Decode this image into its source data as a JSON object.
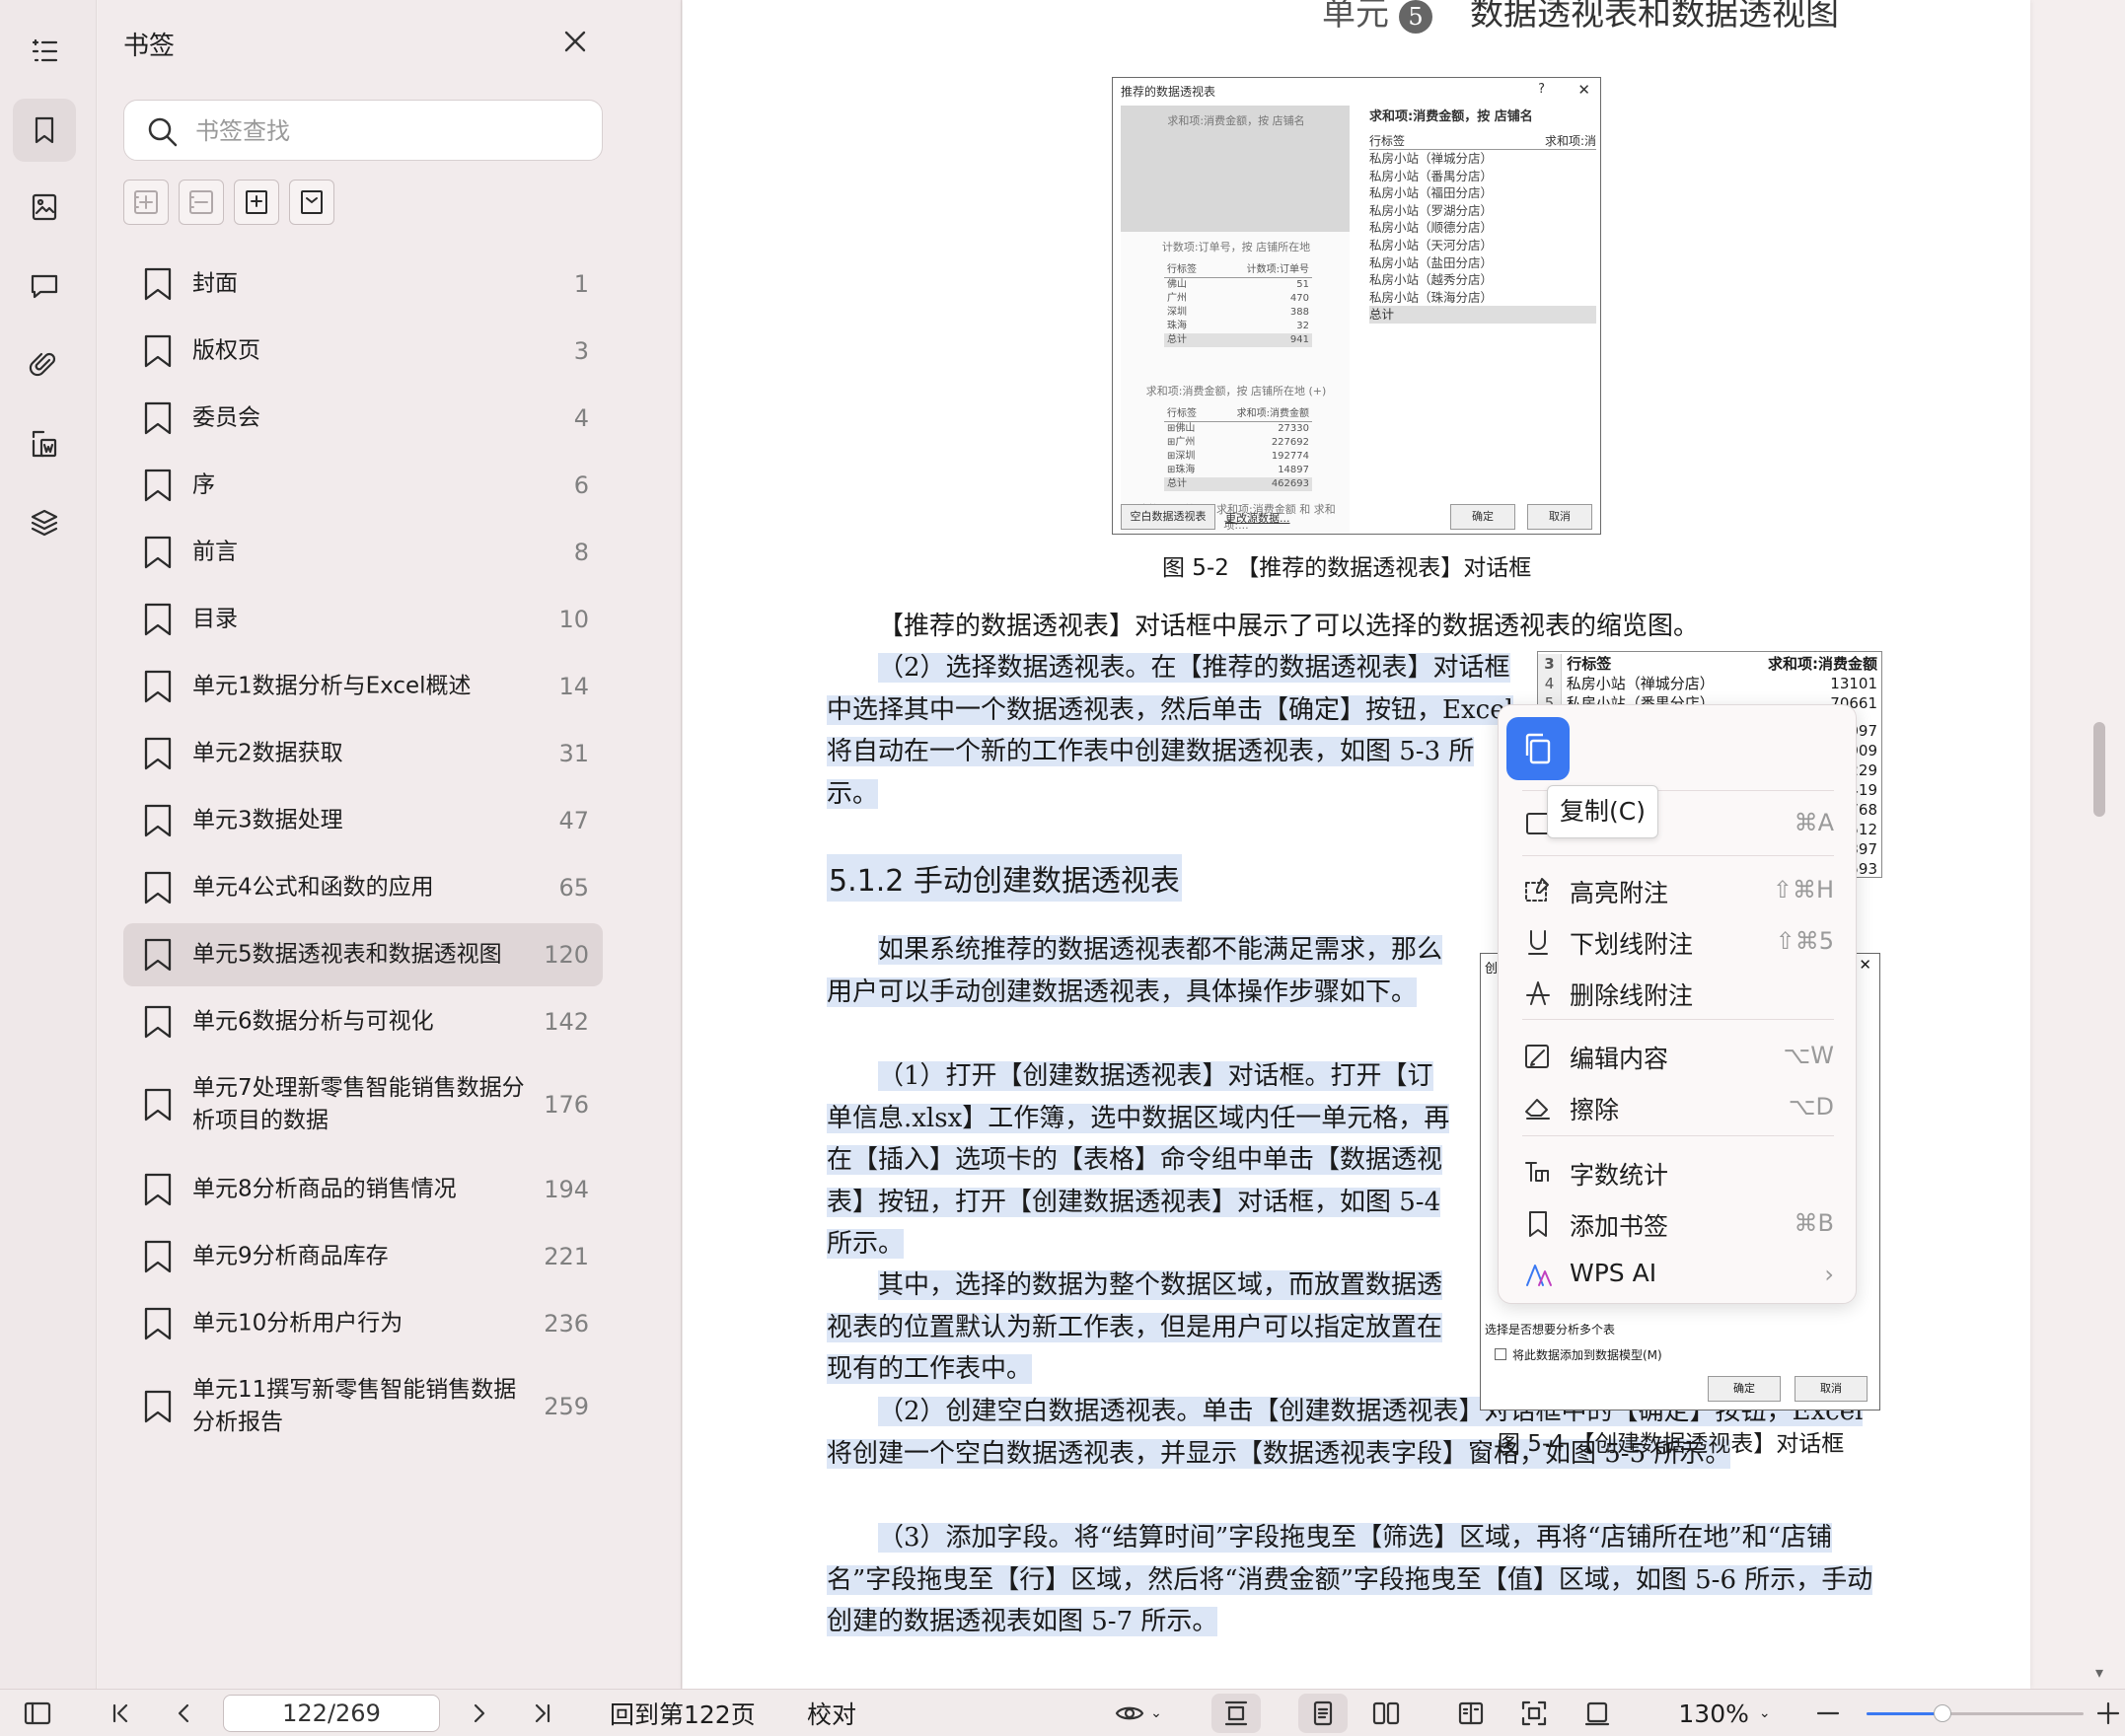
{
  "sidebar": {
    "title": "书签",
    "search_placeholder": "书签查找",
    "bookmarks": [
      {
        "label": "封面",
        "page": "1"
      },
      {
        "label": "版权页",
        "page": "3"
      },
      {
        "label": "委员会",
        "page": "4"
      },
      {
        "label": "序",
        "page": "6"
      },
      {
        "label": "前言",
        "page": "8"
      },
      {
        "label": "目录",
        "page": "10"
      },
      {
        "label": "单元1数据分析与Excel概述",
        "page": "14"
      },
      {
        "label": "单元2数据获取",
        "page": "31"
      },
      {
        "label": "单元3数据处理",
        "page": "47"
      },
      {
        "label": "单元4公式和函数的应用",
        "page": "65"
      },
      {
        "label": "单元5数据透视表和数据透视图",
        "page": "120"
      },
      {
        "label": "单元6数据分析与可视化",
        "page": "142"
      },
      {
        "label": "单元7处理新零售智能销售数据分析项目的数据",
        "page": "176"
      },
      {
        "label": "单元8分析商品的销售情况",
        "page": "194"
      },
      {
        "label": "单元9分析商品库存",
        "page": "221"
      },
      {
        "label": "单元10分析用户行为",
        "page": "236"
      },
      {
        "label": "单元11撰写新零售智能销售数据分析报告",
        "page": "259"
      }
    ],
    "active_index": 10
  },
  "document": {
    "unit_heading_prefix": "单元",
    "unit_number": "5",
    "unit_heading_title": "数据透视表和数据透视图",
    "fig2": {
      "title": "推荐的数据透视表",
      "help": "?",
      "cap1": "求和项:消费金额，按 店铺名",
      "cap2": "计数项:订单号，按 店铺所在地",
      "cap3": "求和项:消费金额，按 店铺所在地 (+)",
      "cap4": "计数项:订单号、求和项:消费金额 和 求和项:...",
      "t2_header": [
        "行标签",
        "计数项:订单号"
      ],
      "t2_rows": [
        [
          "佛山",
          "51"
        ],
        [
          "广州",
          "470"
        ],
        [
          "深圳",
          "388"
        ],
        [
          "珠海",
          "32"
        ]
      ],
      "t2_total": [
        "总计",
        "941"
      ],
      "t3_header": [
        "行标签",
        "求和项:消费金额"
      ],
      "t3_rows": [
        [
          "⊞佛山",
          "27330"
        ],
        [
          "⊞广州",
          "227692"
        ],
        [
          "⊞深圳",
          "192774"
        ],
        [
          "⊞珠海",
          "14897"
        ]
      ],
      "t3_total": [
        "总计",
        "462693"
      ],
      "right_title": "求和项:消费金额，按 店铺名",
      "right_header": [
        "行标签",
        "求和项:消"
      ],
      "right_rows": [
        "私房小站（禅城分店）",
        "私房小站（番禺分店）",
        "私房小站（福田分店）",
        "私房小站（罗湖分店）",
        "私房小站（顺德分店）",
        "私房小站（天河分店）",
        "私房小站（盐田分店）",
        "私房小站（越秀分店）",
        "私房小站（珠海分店）"
      ],
      "right_total": "总计",
      "blank_btn": "空白数据透视表",
      "change_link": "更改源数据...",
      "ok": "确定",
      "cancel": "取消"
    },
    "fig2_caption": "图 5-2 【推荐的数据透视表】对话框",
    "p1": "【推荐的数据透视表】对话框中展示了可以选择的数据透视表的缩览图。",
    "p2": "（2）选择数据透视表。在【推荐的数据透视表】对话框中选择其中一个数据透视表，然后单击【确定】按钮，Excel 将自动在一个新的工作表中创建数据透视表，如图 5-3 所示。",
    "section_heading": "5.1.2 手动创建数据透视表",
    "p3": "如果系统推荐的数据透视表都不能满足需求，那么用户可以手动创建数据透视表，具体操作步骤如下。",
    "p4": "（1）打开【创建数据透视表】对话框。打开【订单信息.xlsx】工作簿，选中数据区域内任一单元格，再在【插入】选项卡的【表格】命令组中单击【数据透视表】按钮，打开【创建数据透视表】对话框，如图 5-4 所示。",
    "p5": "其中，选择的数据为整个数据区域，而放置数据透视表的位置默认为新工作表，但是用户可以指定放置在现有的工作表中。",
    "p6": "（2）创建空白数据透视表。单击【创建数据透视表】对话框中的【确定】按钮，Excel 将创建一个空白数据透视表，并显示【数据透视表字段】窗格，如图 5-5 所示。",
    "p7": "（3）添加字段。将“结算时间”字段拖曳至【筛选】区域，再将“店铺所在地”和“店铺名”字段拖曳至【行】区域，然后将“消费金额”字段拖曳至【值】区域，如图 5-6 所示，手动创建的数据透视表如图 5-7 所示。",
    "fig3": {
      "rows": [
        {
          "n": "3",
          "label": "行标签",
          "value": "求和项:消费金额"
        },
        {
          "n": "4",
          "label": "私房小站（禅城分店）",
          "value": "13101"
        },
        {
          "n": "5",
          "label": "私房小站（番禺分店）",
          "value": "70661"
        }
      ],
      "partial_values": [
        "097",
        "909",
        "229",
        "419",
        "768",
        "512",
        "397",
        "593"
      ]
    },
    "fig4": {
      "title_partial": "创",
      "multi_label": "选择是否想要分析多个表",
      "checkbox_label": "将此数据添加到数据模型(M)",
      "ok": "确定",
      "cancel": "取消"
    },
    "fig4_caption": "图 5-4 【创建数据透视表】对话框"
  },
  "context_menu": {
    "copy_tooltip": "复制(C)",
    "select_all_shortcut": "⌘A",
    "items": [
      {
        "icon": "highlight-note-icon",
        "label": "高亮附注",
        "shortcut": "⇧⌘H"
      },
      {
        "icon": "underline-note-icon",
        "label": "下划线附注",
        "shortcut": "⇧⌘5"
      },
      {
        "icon": "strikethrough-note-icon",
        "label": "删除线附注",
        "shortcut": ""
      },
      {
        "icon": "edit-content-icon",
        "label": "编辑内容",
        "shortcut": "⌥W"
      },
      {
        "icon": "eraser-icon",
        "label": "擦除",
        "shortcut": "⌥D"
      },
      {
        "icon": "word-count-icon",
        "label": "字数统计",
        "shortcut": ""
      },
      {
        "icon": "add-bookmark-icon",
        "label": "添加书签",
        "shortcut": "⌘B"
      },
      {
        "icon": "wps-ai-icon",
        "label": "WPS AI",
        "shortcut": "›"
      }
    ],
    "accent": "#3a78f2"
  },
  "toolbar": {
    "page_value": "122/269",
    "back_to_page": "回到第122页",
    "proofread": "校对",
    "zoom_label": "130%",
    "zoom_slider_fraction": 0.35
  }
}
